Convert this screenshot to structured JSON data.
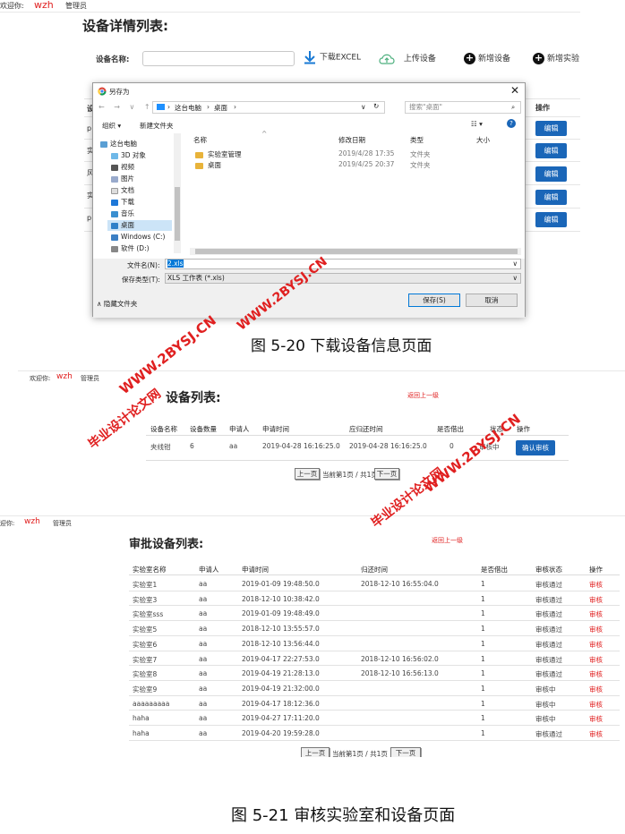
{
  "fig1": {
    "topbar": {
      "welcome": "欢迎你:",
      "user": "wzh",
      "role": "管理员"
    },
    "title": "设备详情列表:",
    "search_label": "设备名称:",
    "toolbar": {
      "download": "下载EXCEL",
      "upload": "上传设备",
      "add_device": "新增设备",
      "add_lab": "新增实验"
    },
    "ops_header": "操作",
    "edit_label": "编辑",
    "row_glimpses": [
      "设",
      "p",
      "实",
      "风",
      "实",
      "p"
    ],
    "dialog": {
      "title": "另存为",
      "breadcrumb": [
        "这台电脑",
        "桌面"
      ],
      "search_placeholder": "搜索\"桌面\"",
      "organize": "组织 ▾",
      "new_folder": "新建文件夹",
      "nav": [
        "这台电脑",
        "3D 对象",
        "视频",
        "图片",
        "文档",
        "下载",
        "音乐",
        "桌面",
        "Windows (C:)",
        "软件 (D:)"
      ],
      "columns": [
        "名称",
        "修改日期",
        "类型",
        "大小"
      ],
      "files": [
        {
          "name": "实验室管理",
          "date": "2019/4/28 17:35",
          "type": "文件夹"
        },
        {
          "name": "桌面",
          "date": "2019/4/25 20:37",
          "type": "文件夹"
        }
      ],
      "filename_label": "文件名(N):",
      "filename": "2.xls",
      "filetype_label": "保存类型(T):",
      "filetype": "XLS 工作表 (*.xls)",
      "hide_folders": "隐藏文件夹",
      "save": "保存(S)",
      "cancel": "取消"
    },
    "caption": "图 5-20 下载设备信息页面"
  },
  "fig2": {
    "topbar": {
      "welcome": "欢迎你:",
      "user": "wzh",
      "role": "管理员"
    },
    "title": "设备列表:",
    "back": "返回上一级",
    "columns": [
      "设备名称",
      "设备数量",
      "申请人",
      "申请时间",
      "应归还时间",
      "是否借出",
      "状态",
      "操作"
    ],
    "rows": [
      {
        "name": "夹线钳",
        "qty": "6",
        "applicant": "aa",
        "apply_time": "2019-04-28 16:16:25.0",
        "return_time": "2019-04-28 16:16:25.0",
        "lent": "0",
        "status": "审核中",
        "action": "确认审核"
      }
    ],
    "pager": {
      "prev": "上一页",
      "info": "当前第1页 / 共1页",
      "next": "下一页"
    }
  },
  "fig3": {
    "topbar": {
      "welcome": "迎你:",
      "user": "wzh",
      "role": "管理员"
    },
    "title": "审批设备列表:",
    "back": "返回上一级",
    "columns": [
      "实验室名称",
      "申请人",
      "申请时间",
      "归还时间",
      "是否借出",
      "审核状态",
      "操作"
    ],
    "rows": [
      {
        "name": "实验室1",
        "applicant": "aa",
        "apply_time": "2019-01-09 19:48:50.0",
        "return_time": "2018-12-10 16:55:04.0",
        "lent": "1",
        "status": "审核通过",
        "action": "审核"
      },
      {
        "name": "实验室3",
        "applicant": "aa",
        "apply_time": "2018-12-10 10:38:42.0",
        "return_time": "",
        "lent": "1",
        "status": "审核通过",
        "action": "审核"
      },
      {
        "name": "实验室sss",
        "applicant": "aa",
        "apply_time": "2019-01-09 19:48:49.0",
        "return_time": "",
        "lent": "1",
        "status": "审核通过",
        "action": "审核"
      },
      {
        "name": "实验室5",
        "applicant": "aa",
        "apply_time": "2018-12-10 13:55:57.0",
        "return_time": "",
        "lent": "1",
        "status": "审核通过",
        "action": "审核"
      },
      {
        "name": "实验室6",
        "applicant": "aa",
        "apply_time": "2018-12-10 13:56:44.0",
        "return_time": "",
        "lent": "1",
        "status": "审核通过",
        "action": "审核"
      },
      {
        "name": "实验室7",
        "applicant": "aa",
        "apply_time": "2019-04-17 22:27:53.0",
        "return_time": "2018-12-10 16:56:02.0",
        "lent": "1",
        "status": "审核通过",
        "action": "审核"
      },
      {
        "name": "实验室8",
        "applicant": "aa",
        "apply_time": "2019-04-19 21:28:13.0",
        "return_time": "2018-12-10 16:56:13.0",
        "lent": "1",
        "status": "审核通过",
        "action": "审核"
      },
      {
        "name": "实验室9",
        "applicant": "aa",
        "apply_time": "2019-04-19 21:32:00.0",
        "return_time": "",
        "lent": "1",
        "status": "审核中",
        "action": "审核"
      },
      {
        "name": "aaaaaaaaa",
        "applicant": "aa",
        "apply_time": "2019-04-17 18:12:36.0",
        "return_time": "",
        "lent": "1",
        "status": "审核中",
        "action": "审核"
      },
      {
        "name": "haha",
        "applicant": "aa",
        "apply_time": "2019-04-27 17:11:20.0",
        "return_time": "",
        "lent": "1",
        "status": "审核中",
        "action": "审核"
      },
      {
        "name": "haha",
        "applicant": "aa",
        "apply_time": "2019-04-20 19:59:28.0",
        "return_time": "",
        "lent": "1",
        "status": "审核通过",
        "action": "审核"
      }
    ],
    "pager": {
      "prev": "上一页",
      "info": "当前第1页 / 共1页",
      "next": "下一页"
    },
    "caption": "图 5-21 审核实验室和设备页面"
  },
  "watermarks": {
    "site": "WWW.2BYSJ.CN",
    "brand": "毕业设计论文网"
  },
  "colors": {
    "accent_red": "#e02020",
    "button_blue": "#1a66b8"
  }
}
